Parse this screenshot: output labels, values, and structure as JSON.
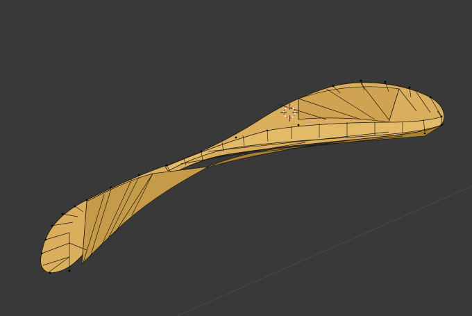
{
  "viewport": {
    "background_color": "#393939",
    "grid_line_color": "#474747",
    "object_fill_color": "#D9AE5C",
    "object_shade_color": "#C59A48",
    "object_dark_color": "#A97F33",
    "wire_color": "#1E1A10",
    "vertex_color": "#000000",
    "cursor_colors": [
      "#E04A3A",
      "#FFFFFF"
    ]
  },
  "icons": {
    "cursor": "3d-cursor-icon"
  }
}
